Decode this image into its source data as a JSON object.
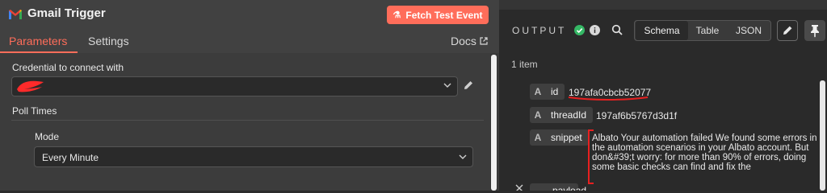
{
  "node": {
    "title": "Gmail Trigger",
    "fetch_button": "Fetch Test Event",
    "brand_color": "#ff6d5a"
  },
  "tabs": [
    {
      "label": "Parameters",
      "active": true
    },
    {
      "label": "Settings",
      "active": false
    }
  ],
  "docs": {
    "label": "Docs",
    "icon": "external-link-icon"
  },
  "parameters": {
    "credential_label": "Credential to connect with",
    "credential_value": "",
    "poll_times_label": "Poll Times",
    "mode_label": "Mode",
    "mode_value": "Every Minute"
  },
  "output": {
    "title": "OUTPUT",
    "status_icon": "success-check-icon",
    "views": [
      "Schema",
      "Table",
      "JSON"
    ],
    "active_view": "Schema",
    "item_count": "1 item",
    "fields": [
      {
        "type": "A",
        "key": "id",
        "value": "197afa0cbcb52077"
      },
      {
        "type": "A",
        "key": "threadId",
        "value": "197af6b5767d3d1f"
      },
      {
        "type": "A",
        "key": "snippet",
        "value": "Albato Your automation failed We found some errors in the automation scenarios in your Albato account. But don&#39;t worry: for more than 90% of errors, doing some basic checks can find and fix the"
      },
      {
        "type": "",
        "key": "payload",
        "value": ""
      }
    ]
  }
}
